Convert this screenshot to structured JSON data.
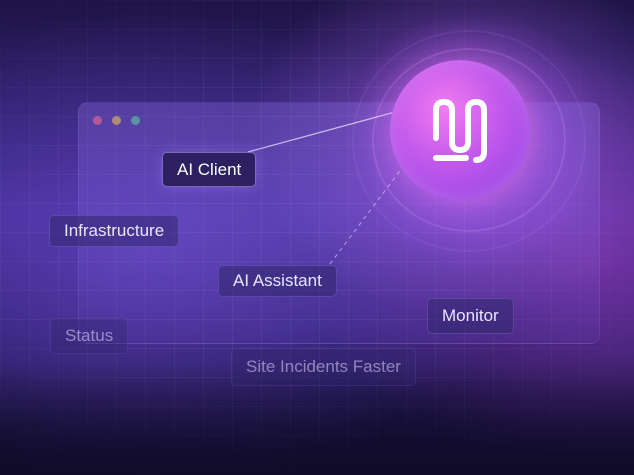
{
  "colors": {
    "accent_pink": "#f27bf0",
    "accent_purple": "#8b3fe0",
    "background_dark": "#1e1446"
  },
  "logo": {
    "icon": "stacked-wave-logo-icon"
  },
  "window_controls": [
    "close-dot",
    "minimize-dot",
    "zoom-dot"
  ],
  "tags": {
    "ai_client": "AI Client",
    "infrastructure": "Infrastructure",
    "ai_assistant": "AI Assistant",
    "monitor": "Monitor",
    "status": "Status",
    "site_incidents": "Site Incidents Faster"
  }
}
